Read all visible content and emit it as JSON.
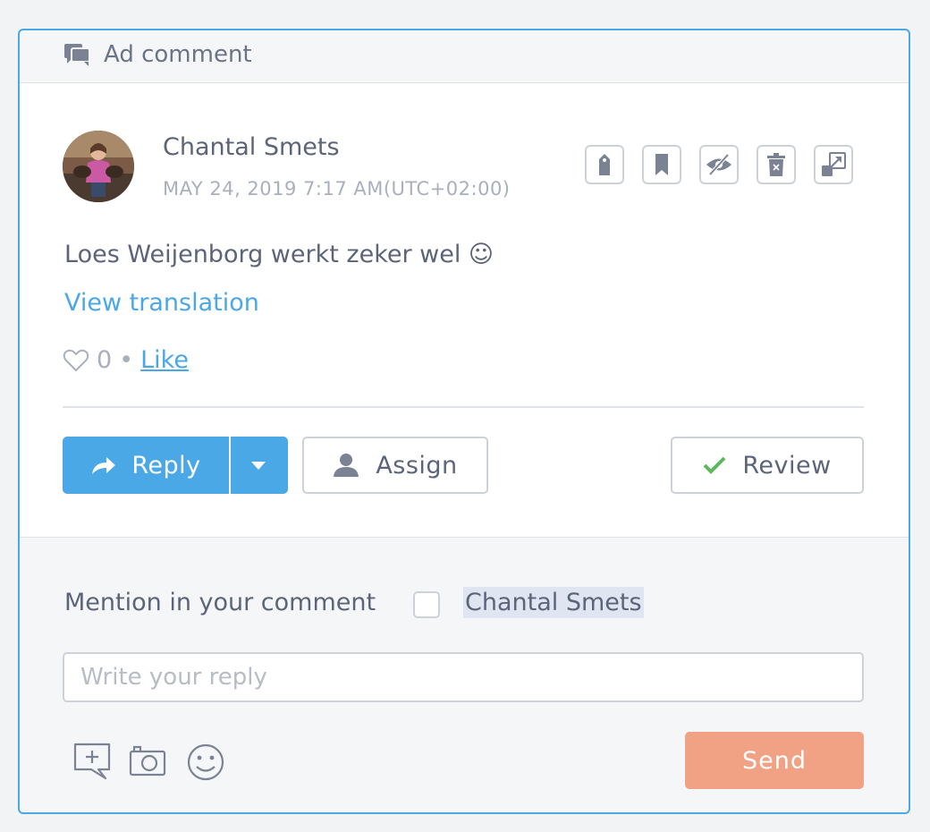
{
  "header": {
    "title": "Ad comment",
    "icon": "comments-icon"
  },
  "comment": {
    "author": "Chantal Smets",
    "timestamp": "MAY 24, 2019 7:17 AM(UTC+02:00)",
    "text": "Loes Weijenborg werkt zeker wel ☺",
    "translate_label": "View translation",
    "like_count": "0",
    "like_separator": "•",
    "like_label": "Like"
  },
  "action_icons": [
    "tag-icon",
    "bookmark-icon",
    "hide-icon",
    "trash-icon",
    "expand-icon"
  ],
  "buttons": {
    "reply": "Reply",
    "assign": "Assign",
    "review": "Review"
  },
  "mention": {
    "label": "Mention in your comment",
    "name": "Chantal Smets"
  },
  "reply_box": {
    "placeholder": "Write your reply"
  },
  "send_label": "Send",
  "colors": {
    "accent": "#4aa8e6",
    "send": "#f1a285",
    "check": "#5cb85c",
    "muted": "#a9afbc",
    "text": "#5b6478"
  }
}
